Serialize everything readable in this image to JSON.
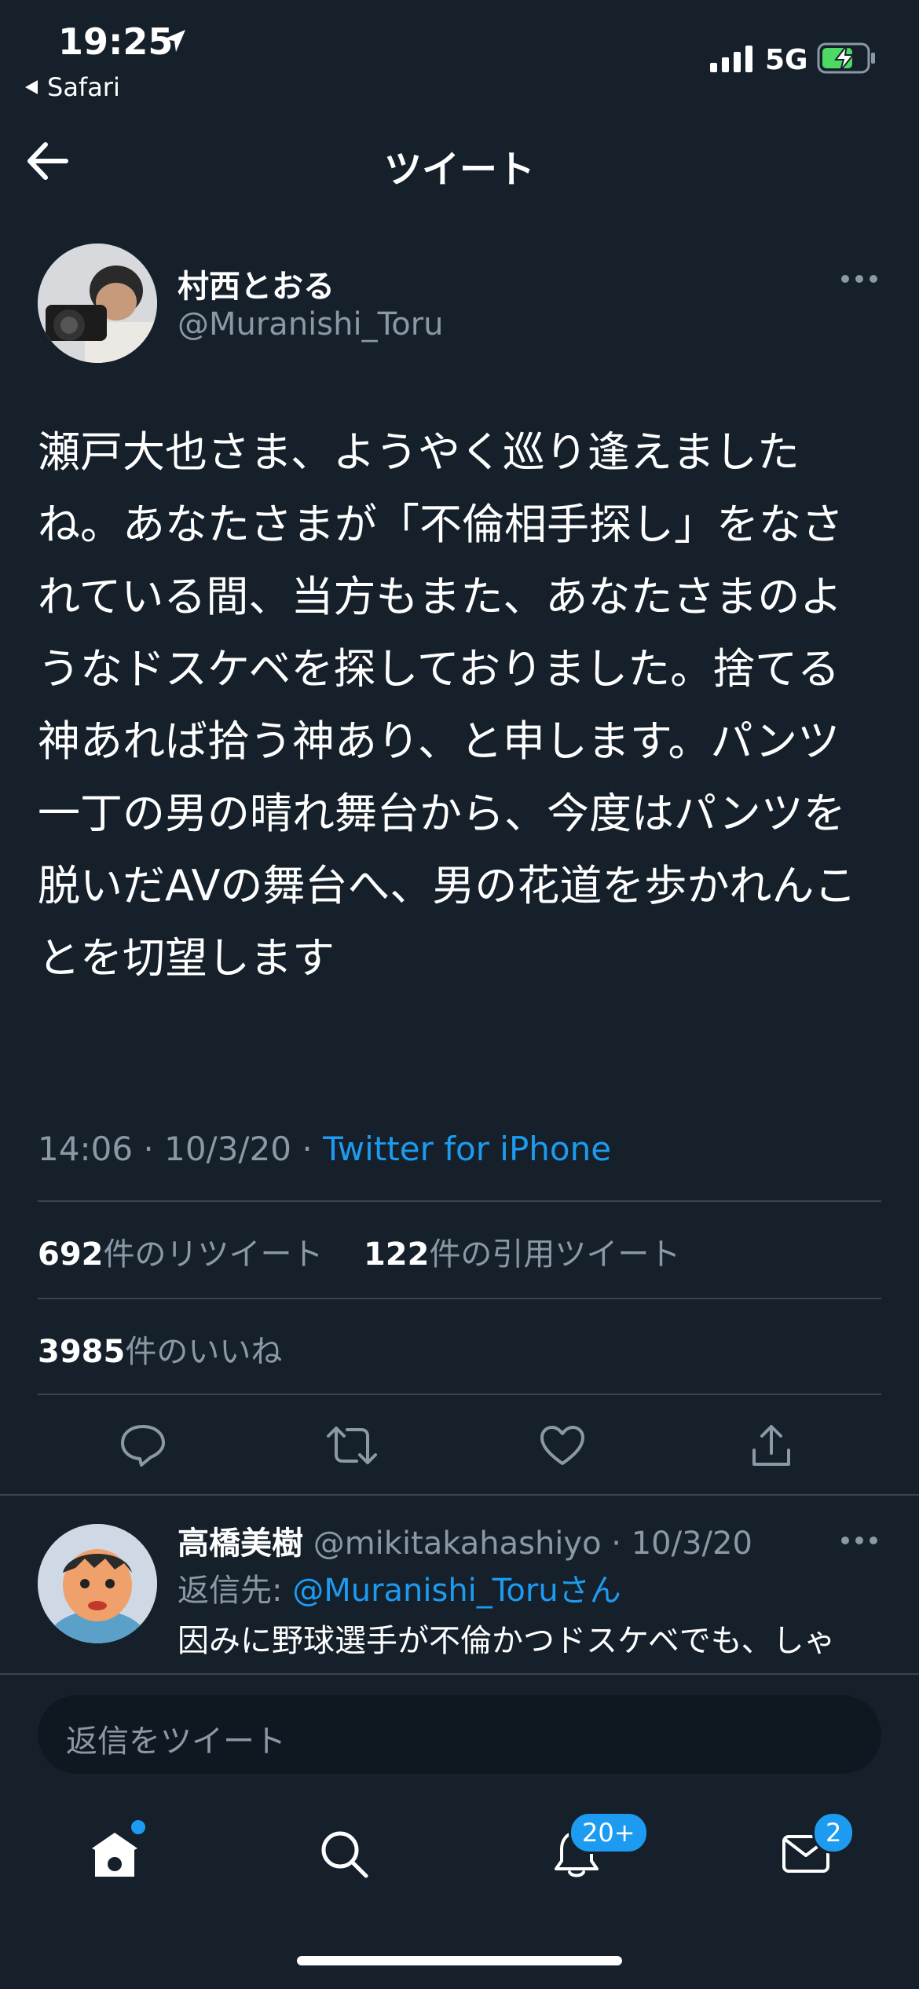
{
  "status_bar": {
    "time": "19:25",
    "back_app": "Safari",
    "network": "5G"
  },
  "header": {
    "title": "ツイート"
  },
  "tweet": {
    "display_name": "村西とおる",
    "handle": "@Muranishi_Toru",
    "text": "瀬戸大也さま、ようやく巡り逢えましたね。あなたさまが「不倫相手探し」をなされている間、当方もまた、あなたさまのようなドスケベを探しておりました。捨てる神あれば拾う神あり、と申します。パンツ一丁の男の晴れ舞台から、今度はパンツを脱いだAVの舞台へ、男の花道を歩かれんことを切望します",
    "time": "14:06",
    "date": "10/3/20",
    "source": "Twitter for iPhone",
    "retweets_count": "692",
    "retweets_label": "件のリツイート",
    "quotes_count": "122",
    "quotes_label": "件の引用ツイート",
    "likes_count": "3985",
    "likes_label": "件のいいね"
  },
  "reply": {
    "display_name": "高橋美樹",
    "handle": "@mikitakahashiyo",
    "date": "10/3/20",
    "replying_prefix": "返信先: ",
    "replying_to": "@Muranishi_Toru",
    "replying_suffix": "さん",
    "text": "因みに野球選手が不倫かつドスケベでも、しゃ"
  },
  "composer": {
    "placeholder": "返信をツイート"
  },
  "tab_bar": {
    "notifications_badge": "20+",
    "messages_badge": "2"
  },
  "colors": {
    "background": "#15202b",
    "accent": "#1d9bf0",
    "muted": "#8b98a5",
    "divider": "#38444d"
  },
  "icons": {
    "back": "arrow-left-icon",
    "more": "more-dots-icon",
    "reply": "comment-icon",
    "retweet": "retweet-icon",
    "like": "heart-icon",
    "share": "share-icon",
    "home": "home-icon",
    "search": "search-icon",
    "notifications": "bell-icon",
    "messages": "envelope-icon"
  }
}
